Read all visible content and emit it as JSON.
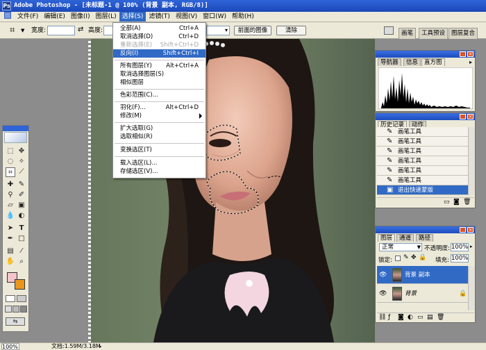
{
  "window": {
    "title": "Adobe Photoshop - [未标题-1 @ 100% (背景 副本, RGB/8)]",
    "logo": "Ps"
  },
  "menubar": {
    "items": [
      "文件(F)",
      "编辑(E)",
      "图像(I)",
      "图层(L)",
      "选择(S)",
      "滤镜(T)",
      "视图(V)",
      "窗口(W)",
      "帮助(H)"
    ],
    "active_index": 4
  },
  "optionsbar": {
    "width_label": "宽度:",
    "height_label": "高度:",
    "swap_icon": "swap-arrows-icon",
    "front_image_button": "前面的图像",
    "clear_button": "清除",
    "tabs": [
      "画笔",
      "工具预设",
      "图层复合"
    ]
  },
  "select_menu": {
    "items": [
      {
        "label": "全部(A)",
        "shortcut": "Ctrl+A",
        "disabled": false
      },
      {
        "label": "取消选择(D)",
        "shortcut": "Ctrl+D",
        "disabled": false
      },
      {
        "label": "重新选择(E)",
        "shortcut": "Shift+Ctrl+D",
        "disabled": true
      },
      {
        "label": "反向(I)",
        "shortcut": "Shift+Ctrl+I",
        "disabled": false,
        "highlighted": true
      },
      {
        "label": "所有图层(Y)",
        "shortcut": "Alt+Ctrl+A",
        "disabled": false
      },
      {
        "label": "取消选择图层(S)",
        "shortcut": "",
        "disabled": false
      },
      {
        "label": "相似图层",
        "shortcut": "",
        "disabled": false
      },
      {
        "label": "色彩范围(C)...",
        "shortcut": "",
        "disabled": false
      },
      {
        "label": "羽化(F)...",
        "shortcut": "Alt+Ctrl+D",
        "disabled": false
      },
      {
        "label": "修改(M)",
        "shortcut": "",
        "disabled": false,
        "submenu": true
      },
      {
        "label": "扩大选取(G)",
        "shortcut": "",
        "disabled": false
      },
      {
        "label": "选取相似(R)",
        "shortcut": "",
        "disabled": false
      },
      {
        "label": "变换选区(T)",
        "shortcut": "",
        "disabled": false
      },
      {
        "label": "载入选区(L)...",
        "shortcut": "",
        "disabled": false
      },
      {
        "label": "存储选区(V)...",
        "shortcut": "",
        "disabled": false
      }
    ]
  },
  "navigator_panel": {
    "tabs": [
      "导航器",
      "信息",
      "直方图"
    ],
    "active_tab": 2
  },
  "history_panel": {
    "tabs": [
      "历史记录",
      "动作"
    ],
    "items": [
      "画笔工具",
      "画笔工具",
      "画笔工具",
      "画笔工具",
      "画笔工具",
      "画笔工具",
      "退出快速蒙版"
    ],
    "selected_index": 6
  },
  "layers_panel": {
    "tabs": [
      "图层",
      "通道",
      "路径"
    ],
    "blend_mode": "正常",
    "opacity_label": "不透明度:",
    "opacity_value": "100%",
    "lock_label": "锁定:",
    "fill_label": "填充:",
    "fill_value": "100%",
    "layers": [
      {
        "name": "背景 副本",
        "selected": true
      },
      {
        "name": "背景",
        "selected": false,
        "locked": true
      }
    ]
  },
  "statusbar": {
    "zoom": "100%",
    "doc_info": "文档:1.59M/3.18M"
  },
  "colors": {
    "foreground": "#f4c6cc",
    "background": "#e8961c",
    "accent": "#316ac5"
  }
}
